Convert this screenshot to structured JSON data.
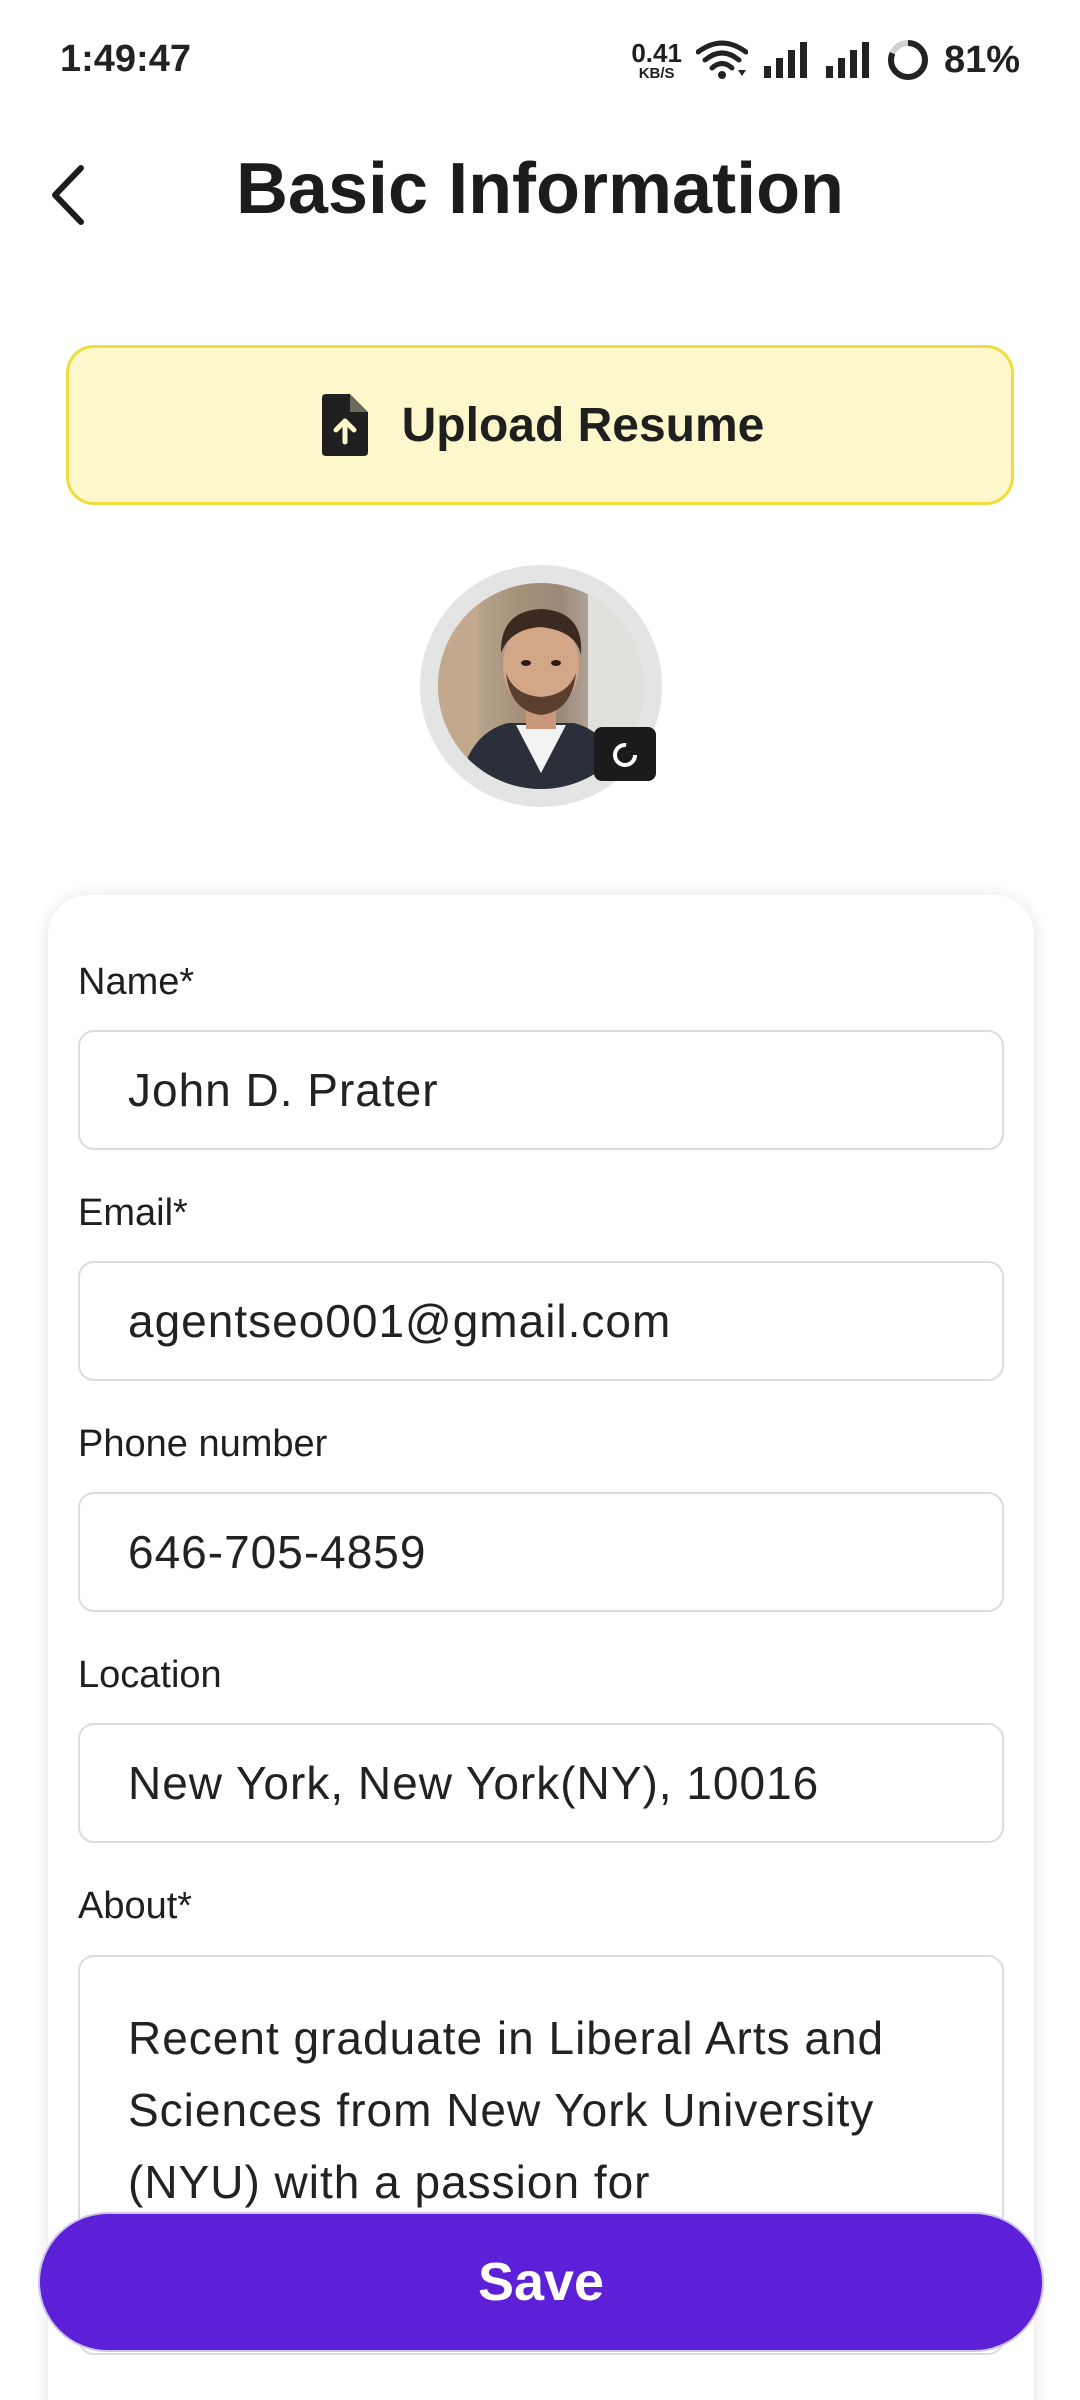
{
  "status_bar": {
    "time": "1:49:47",
    "net_speed_value": "0.41",
    "net_speed_unit": "KB/S",
    "battery_percent": "81%"
  },
  "header": {
    "title": "Basic Information"
  },
  "upload": {
    "label": "Upload Resume"
  },
  "form": {
    "name": {
      "label": "Name*",
      "value": "John D. Prater"
    },
    "email": {
      "label": "Email*",
      "value": "agentseo001@gmail.com"
    },
    "phone": {
      "label": "Phone number",
      "value": "646-705-4859"
    },
    "location": {
      "label": "Location",
      "value": "New York, New York(NY), 10016"
    },
    "about": {
      "label": "About*",
      "value": "Recent graduate in Liberal Arts and Sciences from New York University (NYU) with a passion for"
    }
  },
  "actions": {
    "save_label": "Save"
  },
  "colors": {
    "primary": "#5b20d8",
    "upload_bg": "#fdf8cc",
    "upload_border": "#f0dc3c"
  }
}
